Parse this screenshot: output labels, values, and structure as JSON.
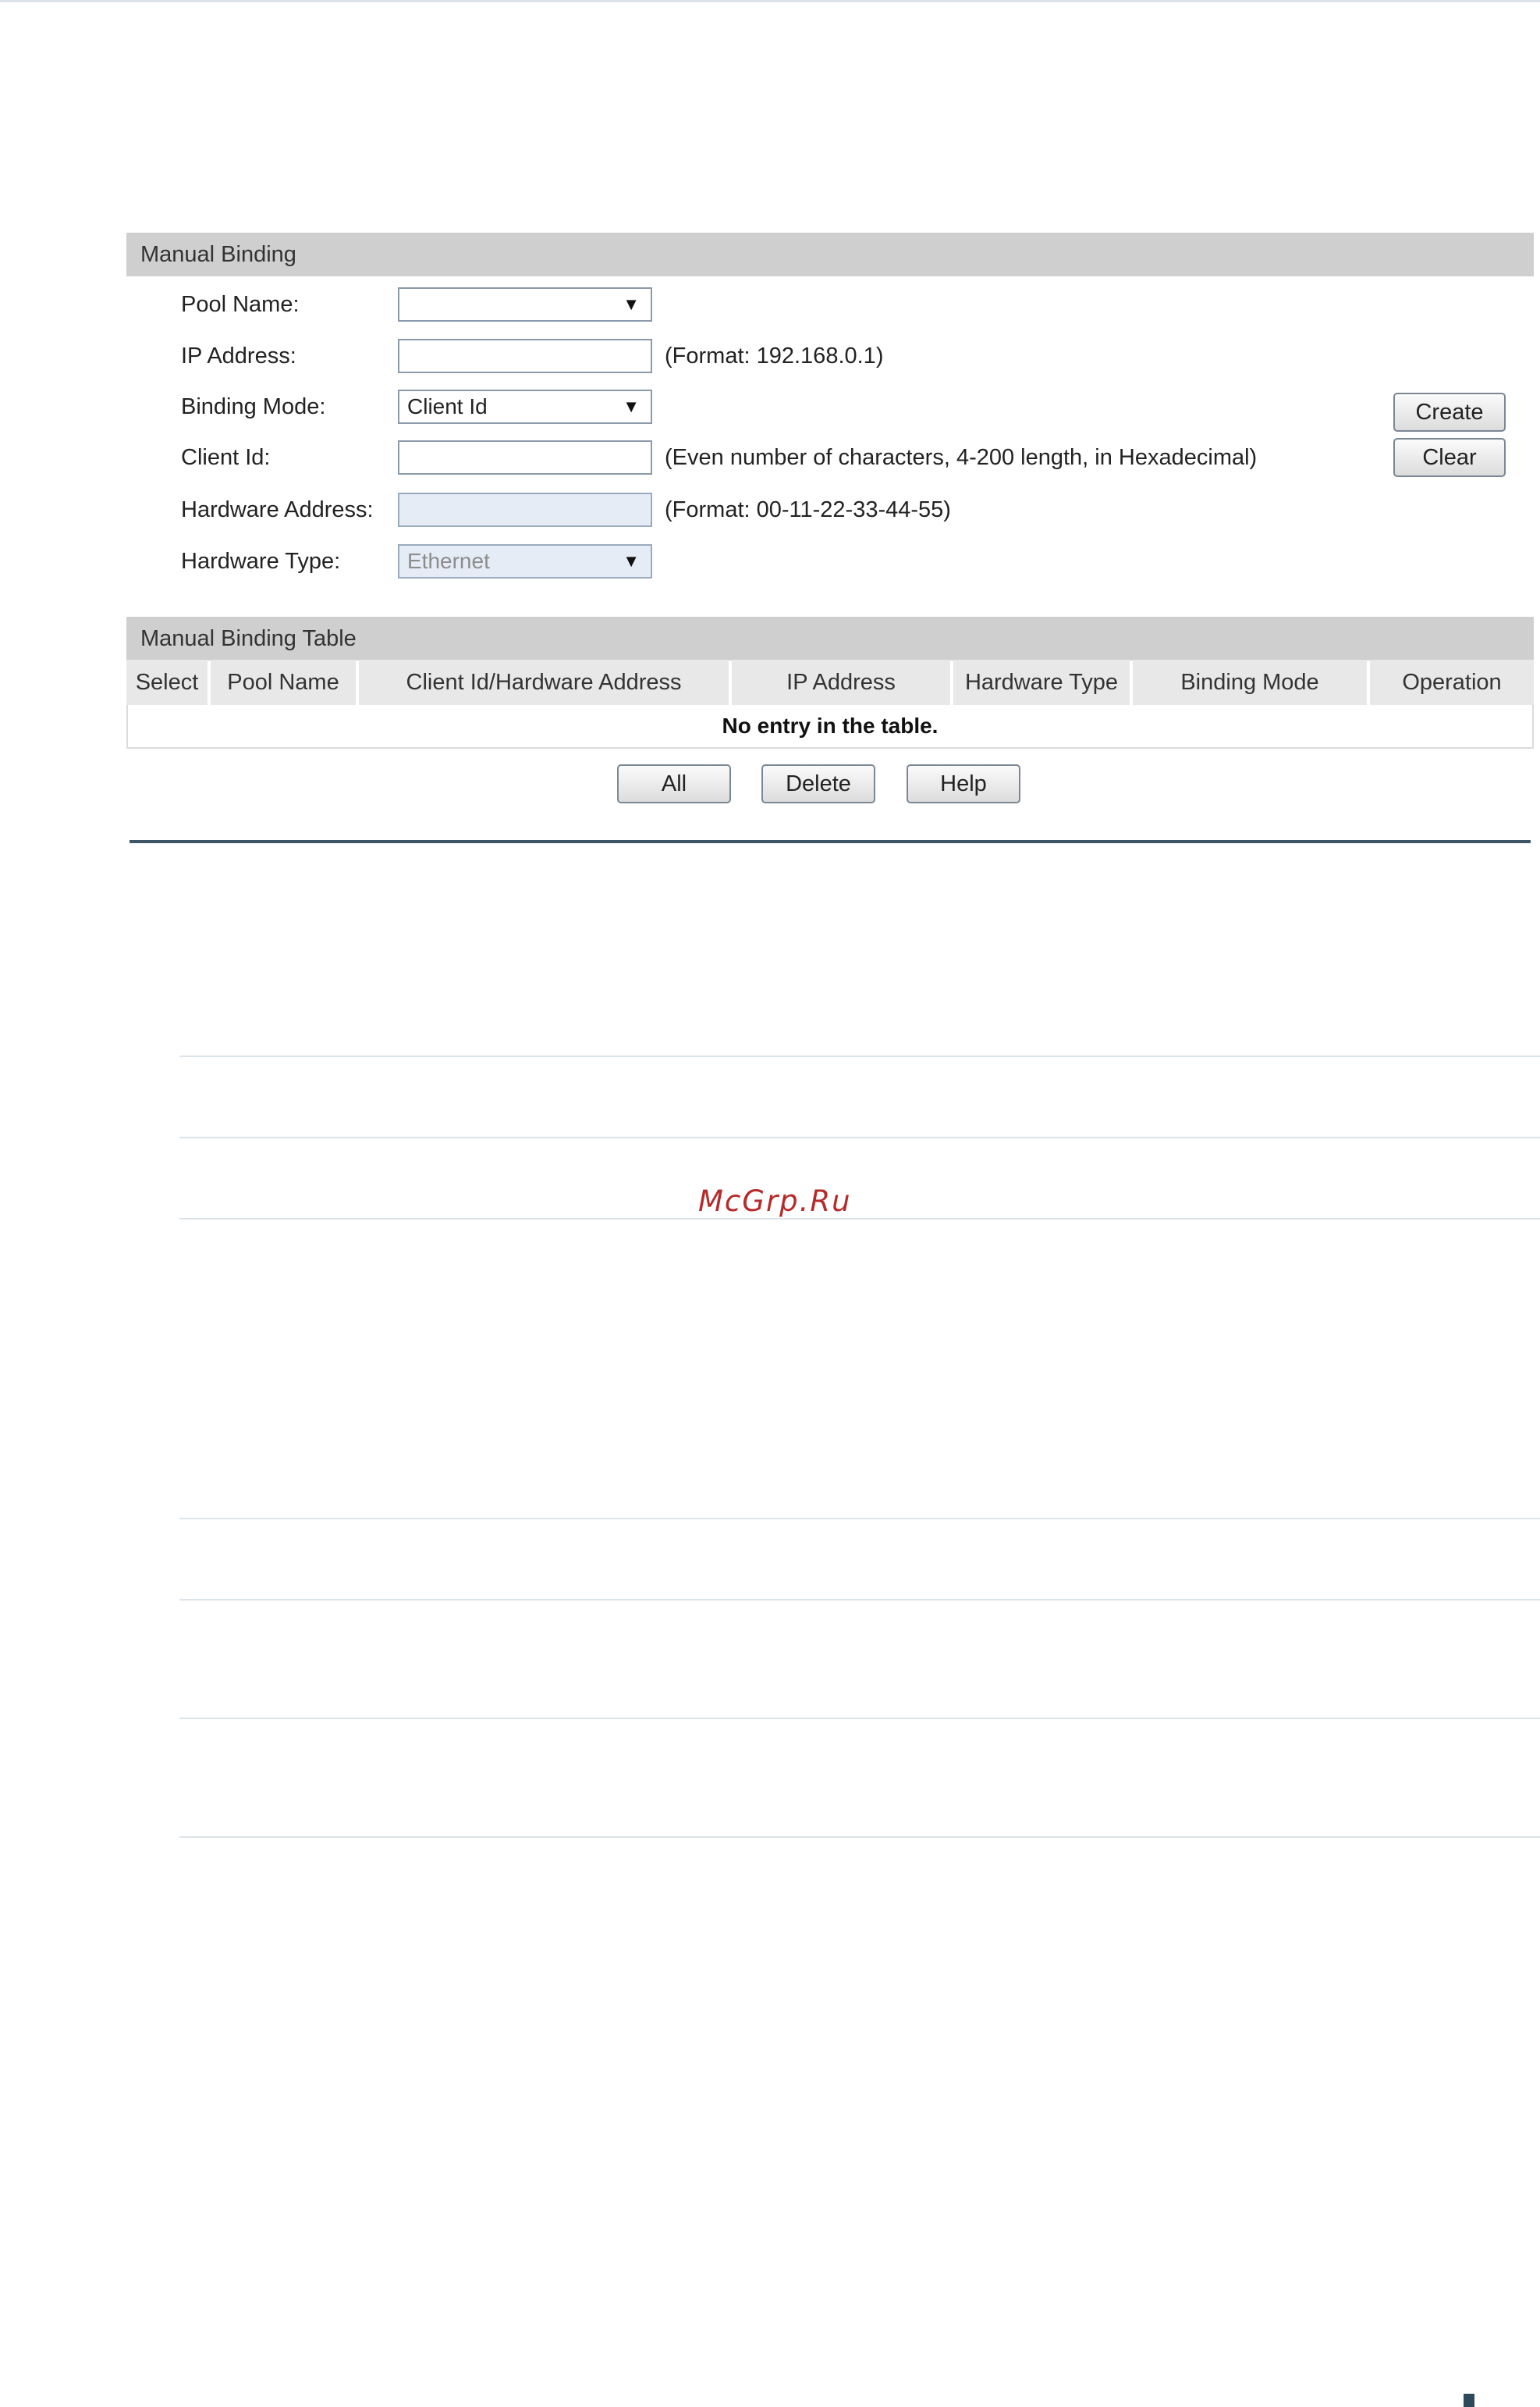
{
  "manual_binding": {
    "title": "Manual Binding",
    "pool_name_label": "Pool Name:",
    "pool_name_value": "",
    "ip_address_label": "IP Address:",
    "ip_address_value": "",
    "ip_address_hint": "(Format: 192.168.0.1)",
    "binding_mode_label": "Binding Mode:",
    "binding_mode_value": "Client Id",
    "client_id_label": "Client Id:",
    "client_id_value": "",
    "client_id_hint": "(Even number of characters, 4-200 length, in Hexadecimal)",
    "hardware_address_label": "Hardware Address:",
    "hardware_address_value": "",
    "hardware_address_hint": "(Format: 00-11-22-33-44-55)",
    "hardware_type_label": "Hardware Type:",
    "hardware_type_value": "Ethernet",
    "create_label": "Create",
    "clear_label": "Clear",
    "dropdown_arrow": "▼"
  },
  "binding_table": {
    "title": "Manual Binding Table",
    "columns": [
      "Select",
      "Pool Name",
      "Client Id/Hardware Address",
      "IP Address",
      "Hardware Type",
      "Binding Mode",
      "Operation"
    ],
    "empty_message": "No entry in the table.",
    "all_label": "All",
    "delete_label": "Delete",
    "help_label": "Help"
  },
  "watermark": "McGrp.Ru",
  "colors": {
    "section_bar": "#cfcfcf",
    "table_header": "#e8e8e8",
    "divider": "#3d5667",
    "watermark": "#b52b2b",
    "disabled_field": "#e6ecf5"
  }
}
